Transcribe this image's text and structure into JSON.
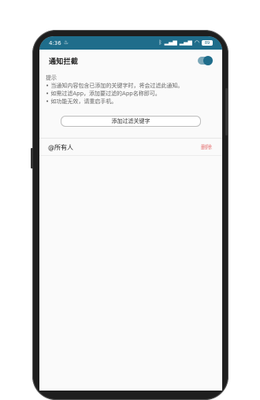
{
  "status_bar": {
    "time": "4:36",
    "battery": "89"
  },
  "header": {
    "title": "通知拦截",
    "toggle_on": true
  },
  "hint": {
    "title": "提示",
    "lines": [
      "• 当通知内容包含已添加的关键字时，将会过滤此通知。",
      "• 如需过滤App，添加要过滤的App名称即可。",
      "• 如功能无效，请重启手机。"
    ]
  },
  "add_button_label": "添加过滤关键字",
  "keywords": [
    {
      "text": "@所有人",
      "delete_label": "删除"
    }
  ],
  "colors": {
    "accent": "#1f6d8b",
    "delete": "#e57373"
  }
}
